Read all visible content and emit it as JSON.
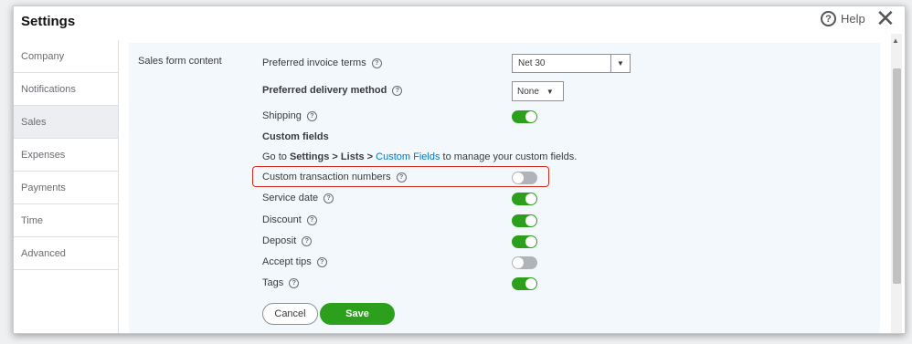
{
  "title": "Settings",
  "help_label": "Help",
  "close_label": "✕",
  "sidebar": {
    "items": [
      {
        "label": "Company"
      },
      {
        "label": "Notifications"
      },
      {
        "label": "Sales"
      },
      {
        "label": "Expenses"
      },
      {
        "label": "Payments"
      },
      {
        "label": "Time"
      },
      {
        "label": "Advanced"
      }
    ],
    "active": "Sales"
  },
  "section_label": "Sales form content",
  "invoice_terms": {
    "label": "Preferred invoice terms",
    "value": "Net 30"
  },
  "delivery_method": {
    "label": "Preferred delivery method",
    "value": "None"
  },
  "shipping": {
    "label": "Shipping",
    "on": true
  },
  "custom_fields": {
    "heading": "Custom fields",
    "text_go_to": "Go to ",
    "text_settings": "Settings",
    "text_sep1": " > ",
    "text_lists": "Lists",
    "text_sep2": " > ",
    "link_label": "Custom Fields",
    "text_suffix": " to manage your custom fields."
  },
  "custom_transaction_numbers": {
    "label": "Custom transaction numbers",
    "on": false
  },
  "service_date": {
    "label": "Service date",
    "on": true
  },
  "discount": {
    "label": "Discount",
    "on": true
  },
  "deposit": {
    "label": "Deposit",
    "on": true
  },
  "accept_tips": {
    "label": "Accept tips",
    "on": false
  },
  "tags": {
    "label": "Tags",
    "on": true
  },
  "buttons": {
    "cancel": "Cancel",
    "save": "Save"
  },
  "colors": {
    "accent": "#2ca01c",
    "link": "#0077c5",
    "highlight": "#d52b1e"
  }
}
